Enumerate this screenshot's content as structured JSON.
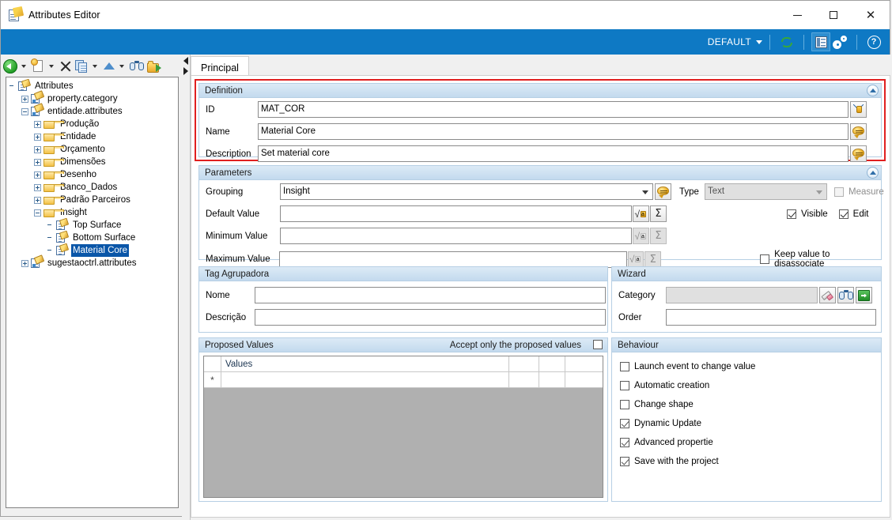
{
  "window": {
    "title": "Attributes Editor",
    "icon": "attributes-editor-icon",
    "minimize": "—",
    "maximize": "□",
    "close": "✕"
  },
  "ribbon": {
    "profile_label": "DEFAULT",
    "icons": [
      "refresh-icon",
      "report-icon",
      "settings-gears-icon",
      "help-icon"
    ],
    "bg_color": "#0e79c4"
  },
  "toolbar": {
    "items": [
      {
        "name": "back-button",
        "icon": "back-arrow-icon",
        "has_dropdown": true
      },
      {
        "name": "new-button",
        "icon": "new-document-icon",
        "has_dropdown": true
      },
      {
        "name": "delete-button",
        "icon": "delete-x-icon",
        "has_dropdown": false
      },
      {
        "name": "copy-button",
        "icon": "copy-icon",
        "has_dropdown": true
      },
      {
        "name": "promote-button",
        "icon": "up-arrow-icon",
        "has_dropdown": true
      },
      {
        "name": "find-button",
        "icon": "binoculars-icon",
        "has_dropdown": false
      },
      {
        "name": "export-button",
        "icon": "export-folder-icon",
        "has_dropdown": false
      }
    ]
  },
  "tree": {
    "root": "Attributes",
    "nodes": [
      {
        "label": "Attributes",
        "depth": 0,
        "expander": "none",
        "icon": "attributes-root-icon",
        "selected": false
      },
      {
        "label": "property.category",
        "depth": 1,
        "expander": "plus",
        "icon": "attribute-file-icon",
        "selected": false
      },
      {
        "label": "entidade.attributes",
        "depth": 1,
        "expander": "minus",
        "icon": "attribute-file-icon",
        "selected": false
      },
      {
        "label": "Produção",
        "depth": 2,
        "expander": "plus",
        "icon": "folder-icon",
        "selected": false
      },
      {
        "label": "Entidade",
        "depth": 2,
        "expander": "plus",
        "icon": "folder-icon",
        "selected": false
      },
      {
        "label": "Orçamento",
        "depth": 2,
        "expander": "plus",
        "icon": "folder-icon",
        "selected": false
      },
      {
        "label": "Dimensões",
        "depth": 2,
        "expander": "plus",
        "icon": "folder-icon",
        "selected": false
      },
      {
        "label": "Desenho",
        "depth": 2,
        "expander": "plus",
        "icon": "folder-icon",
        "selected": false
      },
      {
        "label": "Banco_Dados",
        "depth": 2,
        "expander": "plus",
        "icon": "folder-icon",
        "selected": false
      },
      {
        "label": "Padrão Parceiros",
        "depth": 2,
        "expander": "plus",
        "icon": "folder-icon",
        "selected": false
      },
      {
        "label": "Insight",
        "depth": 2,
        "expander": "minus",
        "icon": "folder-icon",
        "selected": false
      },
      {
        "label": "Top Surface",
        "depth": 3,
        "expander": "none",
        "icon": "attribute-item-icon",
        "selected": false
      },
      {
        "label": "Bottom Surface",
        "depth": 3,
        "expander": "none",
        "icon": "attribute-item-icon",
        "selected": false
      },
      {
        "label": "Material Core",
        "depth": 3,
        "expander": "none",
        "icon": "attribute-item-icon",
        "selected": true
      },
      {
        "label": "sugestaoctrl.attributes",
        "depth": 1,
        "expander": "plus",
        "icon": "attribute-file-icon",
        "selected": false
      }
    ],
    "selection_color": "#0a56a8"
  },
  "tabs": [
    {
      "label": "Principal",
      "active": true
    }
  ],
  "definition": {
    "title": "Definition",
    "highlight_color": "#e02020",
    "fields": [
      {
        "label": "ID",
        "value": "MAT_COR",
        "button_icon": "id-link-icon"
      },
      {
        "label": "Name",
        "value": "Material Core",
        "button_icon": "translate-bubble-icon"
      },
      {
        "label": "Description",
        "value": "Set material core",
        "button_icon": "translate-bubble-icon"
      }
    ]
  },
  "parameters": {
    "title": "Parameters",
    "grouping": {
      "label": "Grouping",
      "value": "Insight",
      "button_icon": "translate-bubble-icon"
    },
    "type": {
      "label": "Type",
      "value": "Text",
      "disabled": true
    },
    "measure": {
      "label": "Measure",
      "checked": false,
      "disabled": true
    },
    "visible": {
      "label": "Visible",
      "checked": true
    },
    "edit": {
      "label": "Edit",
      "checked": true
    },
    "keep_value": {
      "label": "Keep value to disassociate",
      "checked": false
    },
    "value_rows": [
      {
        "label": "Default Value",
        "value": "",
        "formula_enabled": true,
        "sigma_enabled": true
      },
      {
        "label": "Minimum Value",
        "value": "",
        "formula_enabled": false,
        "sigma_enabled": false
      },
      {
        "label": "Maximum Value",
        "value": "",
        "formula_enabled": false,
        "sigma_enabled": false
      }
    ]
  },
  "tag_agrupadora": {
    "title": "Tag Agrupadora",
    "fields": [
      {
        "label": "Nome",
        "value": ""
      },
      {
        "label": "Descrição",
        "value": ""
      }
    ]
  },
  "wizard": {
    "title": "Wizard",
    "category": {
      "label": "Category",
      "value": "",
      "disabled": true
    },
    "order": {
      "label": "Order",
      "value": ""
    },
    "buttons": [
      {
        "name": "clear-category-button",
        "icon": "eraser-icon"
      },
      {
        "name": "find-category-button",
        "icon": "binoculars-icon"
      },
      {
        "name": "go-category-button",
        "icon": "green-arrow-icon"
      }
    ]
  },
  "proposed_values": {
    "title": "Proposed Values",
    "accept_only_label": "Accept only the proposed values",
    "accept_only_checked": false,
    "columns": [
      "",
      "Values",
      "",
      "",
      ""
    ],
    "rows": [
      {
        "marker": "*",
        "value": ""
      }
    ]
  },
  "behaviour": {
    "title": "Behaviour",
    "items": [
      {
        "label": "Launch event to change value",
        "checked": false
      },
      {
        "label": "Automatic creation",
        "checked": false
      },
      {
        "label": "Change shape",
        "checked": false
      },
      {
        "label": "Dynamic Update",
        "checked": true
      },
      {
        "label": "Advanced propertie",
        "checked": true
      },
      {
        "label": "Save with the project",
        "checked": true
      }
    ]
  }
}
